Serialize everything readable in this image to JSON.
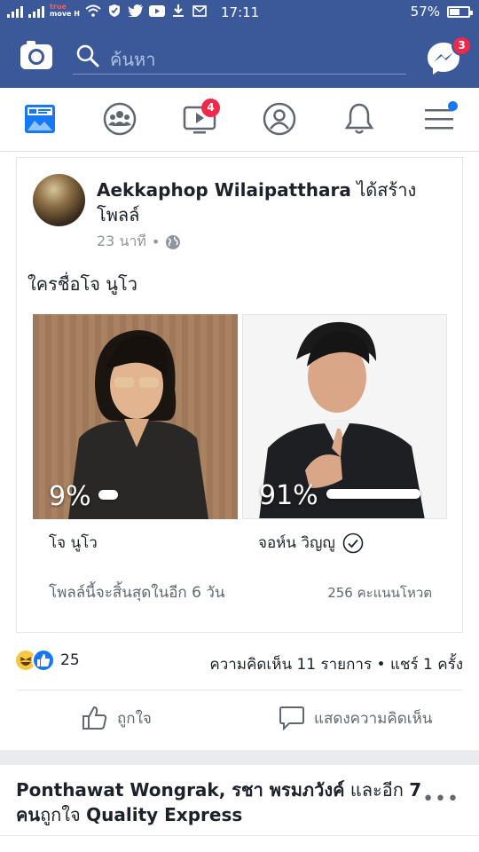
{
  "status_bar": {
    "carrier_line1": "true",
    "carrier_line2": "move H",
    "time": "17:11",
    "battery_text": "57%",
    "battery_level": 0.57
  },
  "top_bar": {
    "search_placeholder": "ค้นหา",
    "messenger_badge": "3"
  },
  "nav_tabs": [
    {
      "name": "news-feed",
      "icon": "newsfeed-icon"
    },
    {
      "name": "groups",
      "icon": "groups-icon"
    },
    {
      "name": "watch",
      "icon": "video-icon",
      "badge": "4"
    },
    {
      "name": "profile",
      "icon": "profile-icon"
    },
    {
      "name": "notifications",
      "icon": "bell-icon"
    },
    {
      "name": "menu",
      "icon": "menu-icon"
    }
  ],
  "post": {
    "author": "Aekkaphop Wilaipatthara",
    "action": " ได้สร้างโพลล์",
    "time": "23 นาที",
    "question": "ใครชื่อโจ นูโว",
    "options": [
      {
        "label": "โจ นูโว",
        "percent_text": "9%",
        "percent": 9,
        "selected": false
      },
      {
        "label": "จอห์น วิญญู",
        "percent_text": "91%",
        "percent": 91,
        "selected": true
      }
    ],
    "poll_end": "โพลล์นี้จะสิ้นสุดในอีก 6 วัน",
    "votes": "256 คะแนนโหวต",
    "reaction_count": "25",
    "comments_shares": "ความคิดเห็น 11 รายการ • แชร์ 1 ครั้ง",
    "like_label": "ถูกใจ",
    "comment_label": "แสดงความคิดเห็น"
  },
  "next_post": {
    "names": "Ponthawat Wongrak, รชา พรมภวังค์",
    "joiner": " และอีก ",
    "others": "7 คน",
    "liked": "ถูกใจ",
    "page": "Quality Express",
    "more": "•••"
  },
  "colors": {
    "brand_blue": "#3b5998",
    "badge_red": "#f02849",
    "like_blue": "#1877f2"
  }
}
